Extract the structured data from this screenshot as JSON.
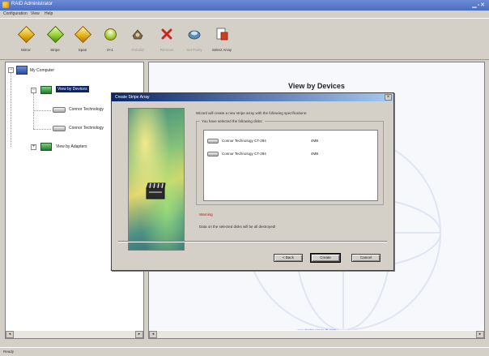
{
  "window": {
    "title": "RAID Administrator"
  },
  "menu": [
    "Configuration",
    "View",
    "Help"
  ],
  "toolbar": [
    {
      "label": "Mirror",
      "icon": "mirror-icon",
      "disabled": false
    },
    {
      "label": "Stripe",
      "icon": "stripe-icon",
      "disabled": false
    },
    {
      "label": "Span",
      "icon": "span-icon",
      "disabled": false
    },
    {
      "label": "0+1",
      "icon": "raid01-icon",
      "disabled": false
    },
    {
      "label": "Rebuild",
      "icon": "rebuild-icon",
      "disabled": true
    },
    {
      "label": "Remove",
      "icon": "remove-icon",
      "disabled": true
    },
    {
      "label": "Set Parity",
      "icon": "parity-icon",
      "disabled": true
    },
    {
      "label": "Select Array",
      "icon": "select-array-icon",
      "disabled": false
    }
  ],
  "tree": {
    "root": "My Computer",
    "view_by_devices": "View by Devices",
    "devices": [
      "Connor Technology",
      "Connor Technology"
    ],
    "view_by_adapters": "View by Adapters"
  },
  "content": {
    "heading": "View by Devices",
    "link": "www.highpoint-tech.com"
  },
  "dialog": {
    "title": "Create Stripe Array",
    "intro": "Wizard will create a new stripe array with the following specifications:",
    "group_title": "You have selected the following disks:",
    "disks": [
      {
        "name": "Connor Technology CT-294",
        "size": "4MB"
      },
      {
        "name": "Connor Technology CT-294",
        "size": "4MB"
      }
    ],
    "warning_label": "Warning",
    "warning_text": "Data on the selected disks will be all destroyed!",
    "buttons": {
      "back": "< Back",
      "create": "Create",
      "cancel": "Cancel"
    }
  },
  "status": "Ready",
  "colors": {
    "titlebar": "#4d6fc0",
    "selection": "#0a246a",
    "warning": "#c01010",
    "link": "#2a3ea8"
  }
}
